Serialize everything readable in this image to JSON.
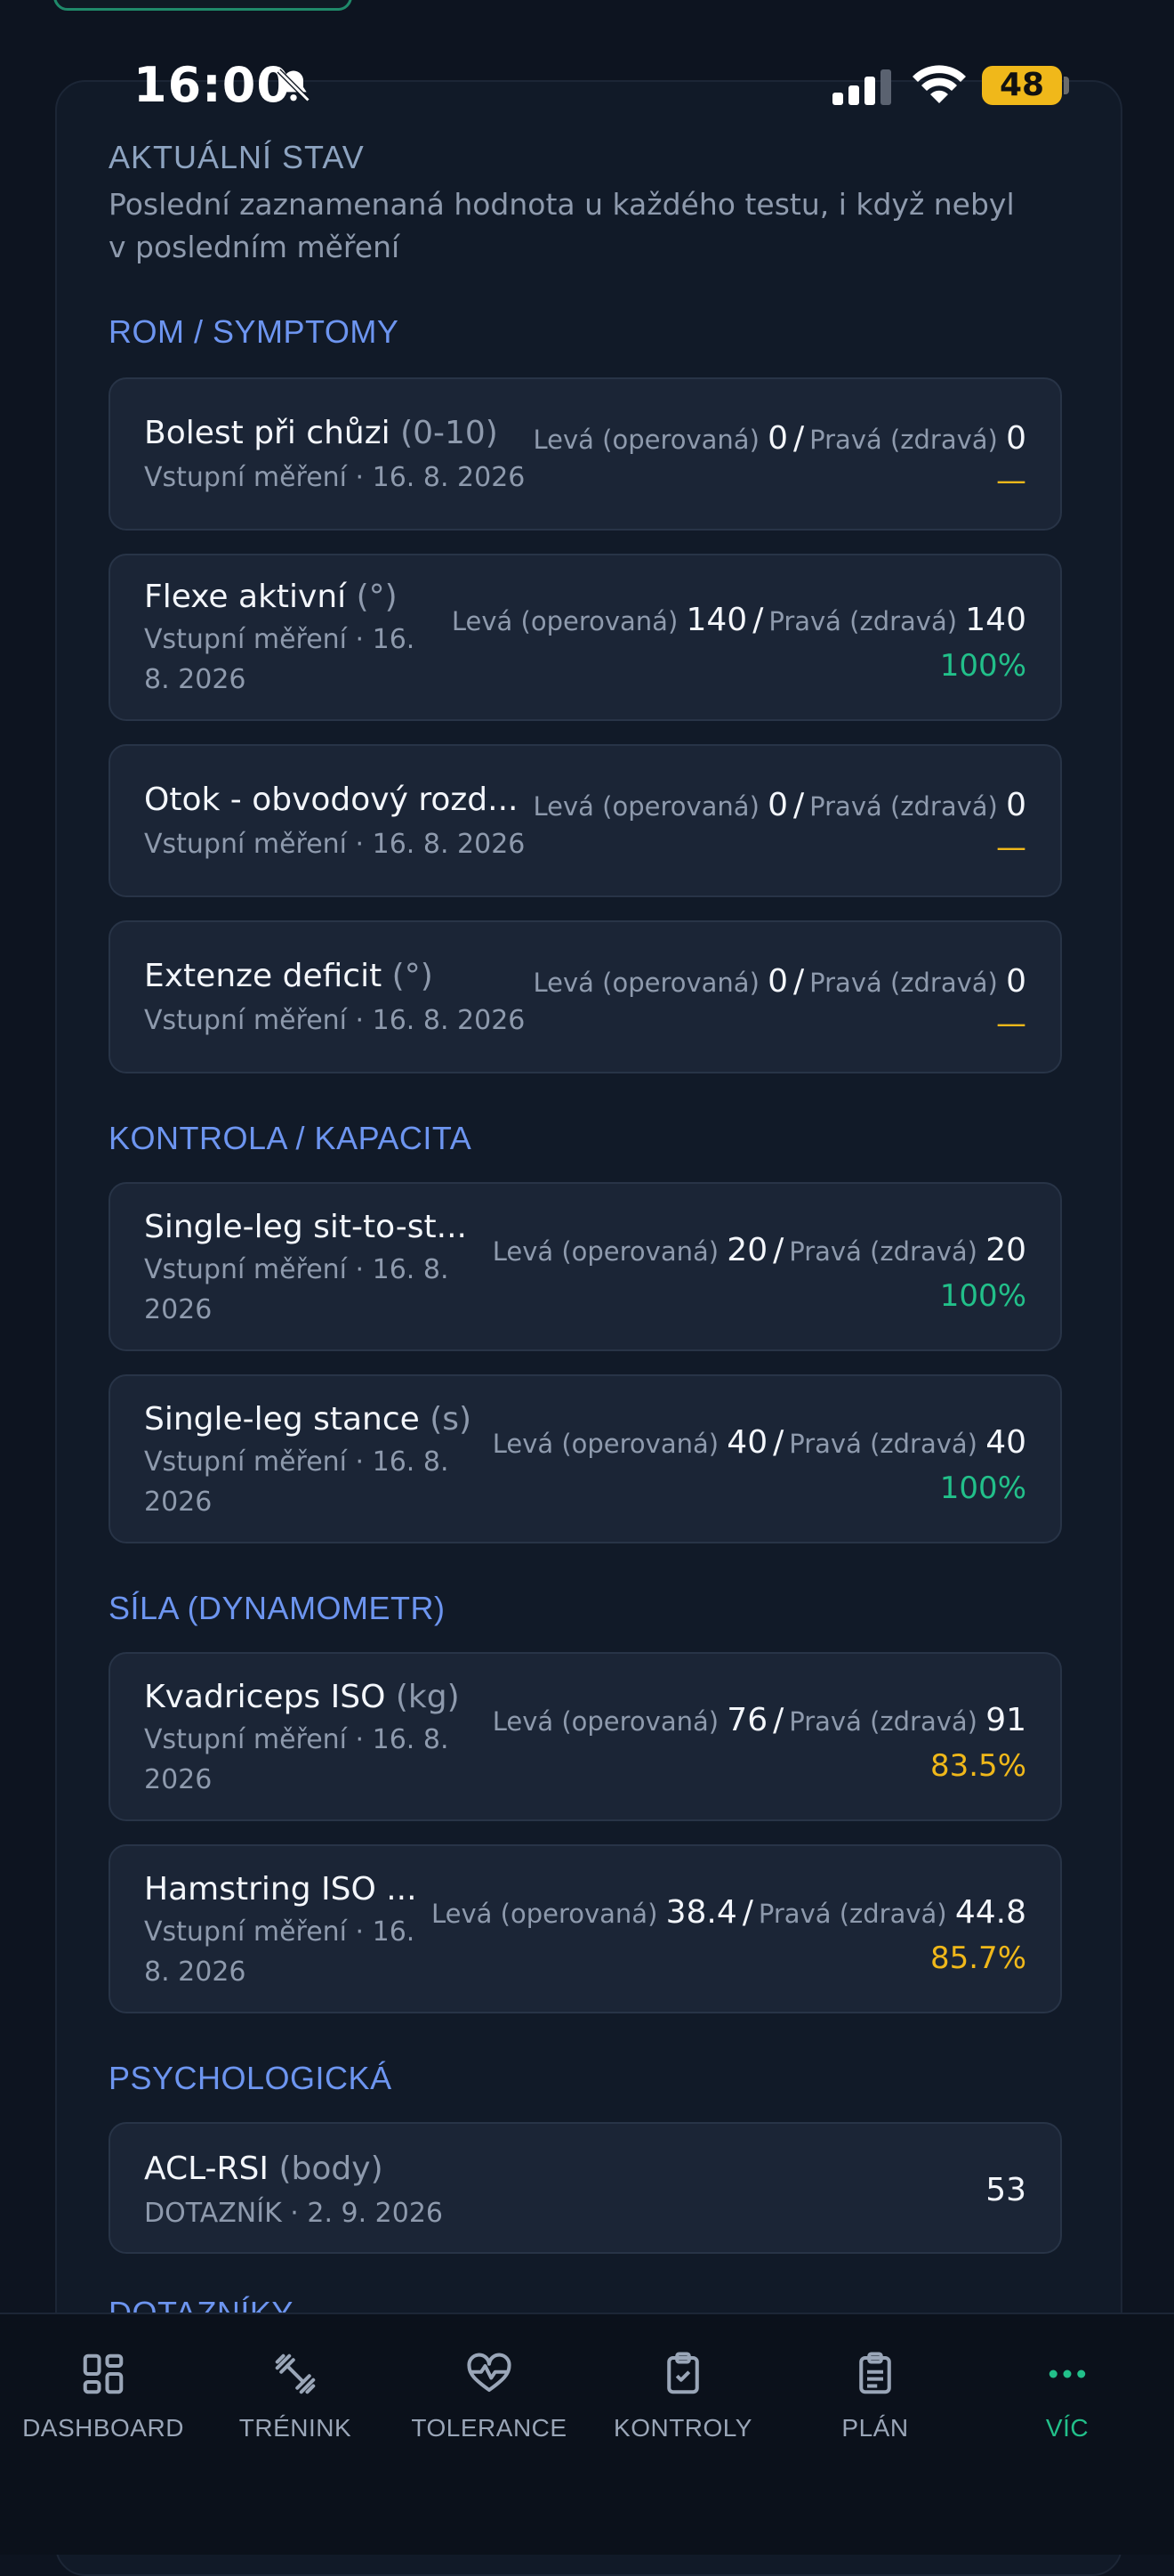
{
  "status_bar": {
    "time": "16:00",
    "battery": "48"
  },
  "current_state": {
    "title": "AKTUÁLNÍ STAV",
    "subtitle": "Poslední zaznamenaná hodnota u každého testu, i když nebyl v posledním měření"
  },
  "groups": [
    {
      "title": "ROM / SYMPTOMY",
      "items": [
        {
          "name": "Bolest při chůzi",
          "unit": "(0-10)",
          "meta": "Vstupní měření · 16. 8. 2026",
          "left_label": "Levá (operovaná)",
          "left_value": "0",
          "right_label": "Pravá (zdravá)",
          "right_value": "0",
          "result": "—",
          "result_color": "#f0b81a"
        },
        {
          "name": "Flexe aktivní",
          "unit": "(°)",
          "meta_lines": [
            "Vstupní měření · 16.",
            "8. 2026"
          ],
          "left_label": "Levá (operovaná)",
          "left_value": "140",
          "right_label": "Pravá (zdravá)",
          "right_value": "140",
          "result": "100%",
          "result_color": "#22c08a"
        },
        {
          "name": "Otok - obvodový rozd...",
          "unit": "",
          "meta": "Vstupní měření · 16. 8. 2026",
          "left_label": "Levá (operovaná)",
          "left_value": "0",
          "right_label": "Pravá (zdravá)",
          "right_value": "0",
          "result": "—",
          "result_color": "#f0b81a"
        },
        {
          "name": "Extenze deficit",
          "unit": "(°)",
          "meta": "Vstupní měření · 16. 8. 2026",
          "left_label": "Levá (operovaná)",
          "left_value": "0",
          "right_label": "Pravá (zdravá)",
          "right_value": "0",
          "result": "—",
          "result_color": "#f0b81a"
        }
      ]
    },
    {
      "title": "KONTROLA / KAPACITA",
      "items": [
        {
          "name": "Single-leg sit-to-st...",
          "unit": "",
          "meta_lines": [
            "Vstupní měření · 16. 8.",
            "2026"
          ],
          "left_label": "Levá (operovaná)",
          "left_value": "20",
          "right_label": "Pravá (zdravá)",
          "right_value": "20",
          "result": "100%",
          "result_color": "#22c08a"
        },
        {
          "name": "Single-leg stance",
          "unit": "(s)",
          "meta_lines": [
            "Vstupní měření · 16. 8.",
            "2026"
          ],
          "left_label": "Levá (operovaná)",
          "left_value": "40",
          "right_label": "Pravá (zdravá)",
          "right_value": "40",
          "result": "100%",
          "result_color": "#22c08a"
        }
      ]
    },
    {
      "title": "SÍLA (DYNAMOMETR)",
      "items": [
        {
          "name": "Kvadriceps ISO",
          "unit": "(kg)",
          "meta_lines": [
            "Vstupní měření · 16. 8.",
            "2026"
          ],
          "left_label": "Levá (operovaná)",
          "left_value": "76",
          "right_label": "Pravá (zdravá)",
          "right_value": "91",
          "result": "83.5%",
          "result_color": "#f0b81a"
        },
        {
          "name": "Hamstring ISO ...",
          "unit": "",
          "meta_lines": [
            "Vstupní měření · 16.",
            "8. 2026"
          ],
          "left_label": "Levá (operovaná)",
          "left_value": "38.4",
          "right_label": "Pravá (zdravá)",
          "right_value": "44.8",
          "result": "85.7%",
          "result_color": "#f0b81a"
        }
      ]
    },
    {
      "title": "PSYCHOLOGICKÁ",
      "items": [
        {
          "name": "ACL-RSI",
          "unit": "(body)",
          "meta": "DOTAZNÍK · 2. 9. 2026",
          "value": "53"
        }
      ]
    },
    {
      "title": "DOTAZNÍKY",
      "items": []
    }
  ],
  "nav": [
    {
      "label": "DASHBOARD",
      "icon": "dashboard-icon"
    },
    {
      "label": "TRÉNINK",
      "icon": "dumbbell-icon"
    },
    {
      "label": "TOLERANCE",
      "icon": "heart-pulse-icon"
    },
    {
      "label": "KONTROLY",
      "icon": "clipboard-check-icon"
    },
    {
      "label": "PLÁN",
      "icon": "clipboard-list-icon"
    },
    {
      "label": "VÍC",
      "icon": "more-icon",
      "active": true
    }
  ],
  "colors": {
    "accent_green": "#22c08a",
    "warning_amber": "#f0b81a",
    "group_title_blue": "#6d95f0"
  }
}
